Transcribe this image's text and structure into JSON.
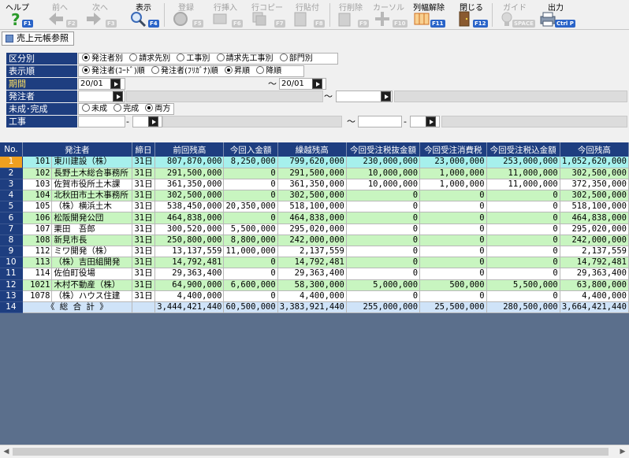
{
  "toolbar": {
    "help": {
      "label": "ヘルプ",
      "key": "F1"
    },
    "prev": {
      "label": "前へ",
      "key": "F2"
    },
    "next": {
      "label": "次へ",
      "key": "F3"
    },
    "show": {
      "label": "表示",
      "key": "F4"
    },
    "register": {
      "label": "登録",
      "key": "F5"
    },
    "row_insert": {
      "label": "行挿入",
      "key": "F6"
    },
    "row_copy": {
      "label": "行コピー",
      "key": "F7"
    },
    "row_paste": {
      "label": "行貼付",
      "key": "F8"
    },
    "row_delete": {
      "label": "行削除",
      "key": "F9"
    },
    "cursor": {
      "label": "カーソル",
      "key": "F10"
    },
    "col_width_reset": {
      "label": "列幅解除",
      "key": "F11"
    },
    "close": {
      "label": "閉じる",
      "key": "F12"
    },
    "guide": {
      "label": "ガイド",
      "key": "SPACE"
    },
    "output": {
      "label": "出力",
      "key": "Ctrl P"
    }
  },
  "tab": {
    "label": "売上元帳参照"
  },
  "filters": {
    "division": {
      "label": "区分別",
      "options": [
        "発注者別",
        "請求先別",
        "工事別",
        "請求先工事別",
        "部門別"
      ],
      "selected": 0
    },
    "display_order": {
      "label": "表示順",
      "options": [
        "発注者(ｺｰﾄﾞ)順",
        "発注者(ﾌﾘｶﾞﾅ)順",
        "昇順",
        "降順"
      ],
      "selected": [
        0,
        2
      ]
    },
    "period": {
      "label": "期間",
      "from": "20/01",
      "tilde": "～",
      "to": "20/01"
    },
    "orderer": {
      "label": "発注者",
      "tilde": "～"
    },
    "status": {
      "label": "未成･完成",
      "options": [
        "未成",
        "完成",
        "両方"
      ],
      "selected": 2
    },
    "construction": {
      "label": "工事",
      "dash": "-",
      "tilde": "～"
    }
  },
  "grid": {
    "columns": [
      "No.",
      "発注者",
      "締日",
      "前回残高",
      "今回入金額",
      "繰越残高",
      "今回受注税抜金額",
      "今回受注消費税",
      "今回受注税込金額",
      "今回残高"
    ],
    "rows": [
      {
        "no": "1",
        "code": "101",
        "name": "東川建設（株）",
        "close": "31日",
        "prev": "807,870,000",
        "recv": "8,250,000",
        "carry": "799,620,000",
        "excl": "230,000,000",
        "tax": "23,000,000",
        "incl": "253,000,000",
        "bal": "1,052,620,000"
      },
      {
        "no": "2",
        "code": "102",
        "name": "長野土木総合事務所",
        "close": "31日",
        "prev": "291,500,000",
        "recv": "0",
        "carry": "291,500,000",
        "excl": "10,000,000",
        "tax": "1,000,000",
        "incl": "11,000,000",
        "bal": "302,500,000"
      },
      {
        "no": "3",
        "code": "103",
        "name": "佐賀市役所土木課",
        "close": "31日",
        "prev": "361,350,000",
        "recv": "0",
        "carry": "361,350,000",
        "excl": "10,000,000",
        "tax": "1,000,000",
        "incl": "11,000,000",
        "bal": "372,350,000"
      },
      {
        "no": "4",
        "code": "104",
        "name": "北秋田市土木事務所",
        "close": "31日",
        "prev": "302,500,000",
        "recv": "0",
        "carry": "302,500,000",
        "excl": "0",
        "tax": "0",
        "incl": "0",
        "bal": "302,500,000"
      },
      {
        "no": "5",
        "code": "105",
        "name": "（株）横浜土木",
        "close": "31日",
        "prev": "538,450,000",
        "recv": "20,350,000",
        "carry": "518,100,000",
        "excl": "0",
        "tax": "0",
        "incl": "0",
        "bal": "518,100,000"
      },
      {
        "no": "6",
        "code": "106",
        "name": "松阪開発公団",
        "close": "31日",
        "prev": "464,838,000",
        "recv": "0",
        "carry": "464,838,000",
        "excl": "0",
        "tax": "0",
        "incl": "0",
        "bal": "464,838,000"
      },
      {
        "no": "7",
        "code": "107",
        "name": "栗田　吾郎",
        "close": "31日",
        "prev": "300,520,000",
        "recv": "5,500,000",
        "carry": "295,020,000",
        "excl": "0",
        "tax": "0",
        "incl": "0",
        "bal": "295,020,000"
      },
      {
        "no": "8",
        "code": "108",
        "name": "新見市長",
        "close": "31日",
        "prev": "250,800,000",
        "recv": "8,800,000",
        "carry": "242,000,000",
        "excl": "0",
        "tax": "0",
        "incl": "0",
        "bal": "242,000,000"
      },
      {
        "no": "9",
        "code": "112",
        "name": "ミワ開発（株）",
        "close": "31日",
        "prev": "13,137,559",
        "recv": "11,000,000",
        "carry": "2,137,559",
        "excl": "0",
        "tax": "0",
        "incl": "0",
        "bal": "2,137,559"
      },
      {
        "no": "10",
        "code": "113",
        "name": "（株）吉田組開発",
        "close": "31日",
        "prev": "14,792,481",
        "recv": "0",
        "carry": "14,792,481",
        "excl": "0",
        "tax": "0",
        "incl": "0",
        "bal": "14,792,481"
      },
      {
        "no": "11",
        "code": "114",
        "name": "佐伯町役場",
        "close": "31日",
        "prev": "29,363,400",
        "recv": "0",
        "carry": "29,363,400",
        "excl": "0",
        "tax": "0",
        "incl": "0",
        "bal": "29,363,400"
      },
      {
        "no": "12",
        "code": "1021",
        "name": "木村不動産（株）",
        "close": "31日",
        "prev": "64,900,000",
        "recv": "6,600,000",
        "carry": "58,300,000",
        "excl": "5,000,000",
        "tax": "500,000",
        "incl": "5,500,000",
        "bal": "63,800,000"
      },
      {
        "no": "13",
        "code": "1078",
        "name": "（株）ハウス住建",
        "close": "31日",
        "prev": "4,400,000",
        "recv": "0",
        "carry": "4,400,000",
        "excl": "0",
        "tax": "0",
        "incl": "0",
        "bal": "4,400,000"
      }
    ],
    "total": {
      "no": "14",
      "name": "《 総 合 計 》",
      "prev": "3,444,421,440",
      "recv": "60,500,000",
      "carry": "3,383,921,440",
      "excl": "255,000,000",
      "tax": "25,500,000",
      "incl": "280,500,000",
      "bal": "3,664,421,440"
    }
  },
  "colors": {
    "header": "#1e3e80",
    "row_even": "#c8f5c0",
    "row_selected": "#a6f0ec",
    "grid_bg": "#5b6f8c",
    "total": "#cfe3f8",
    "selected_marker": "#f0a020"
  }
}
